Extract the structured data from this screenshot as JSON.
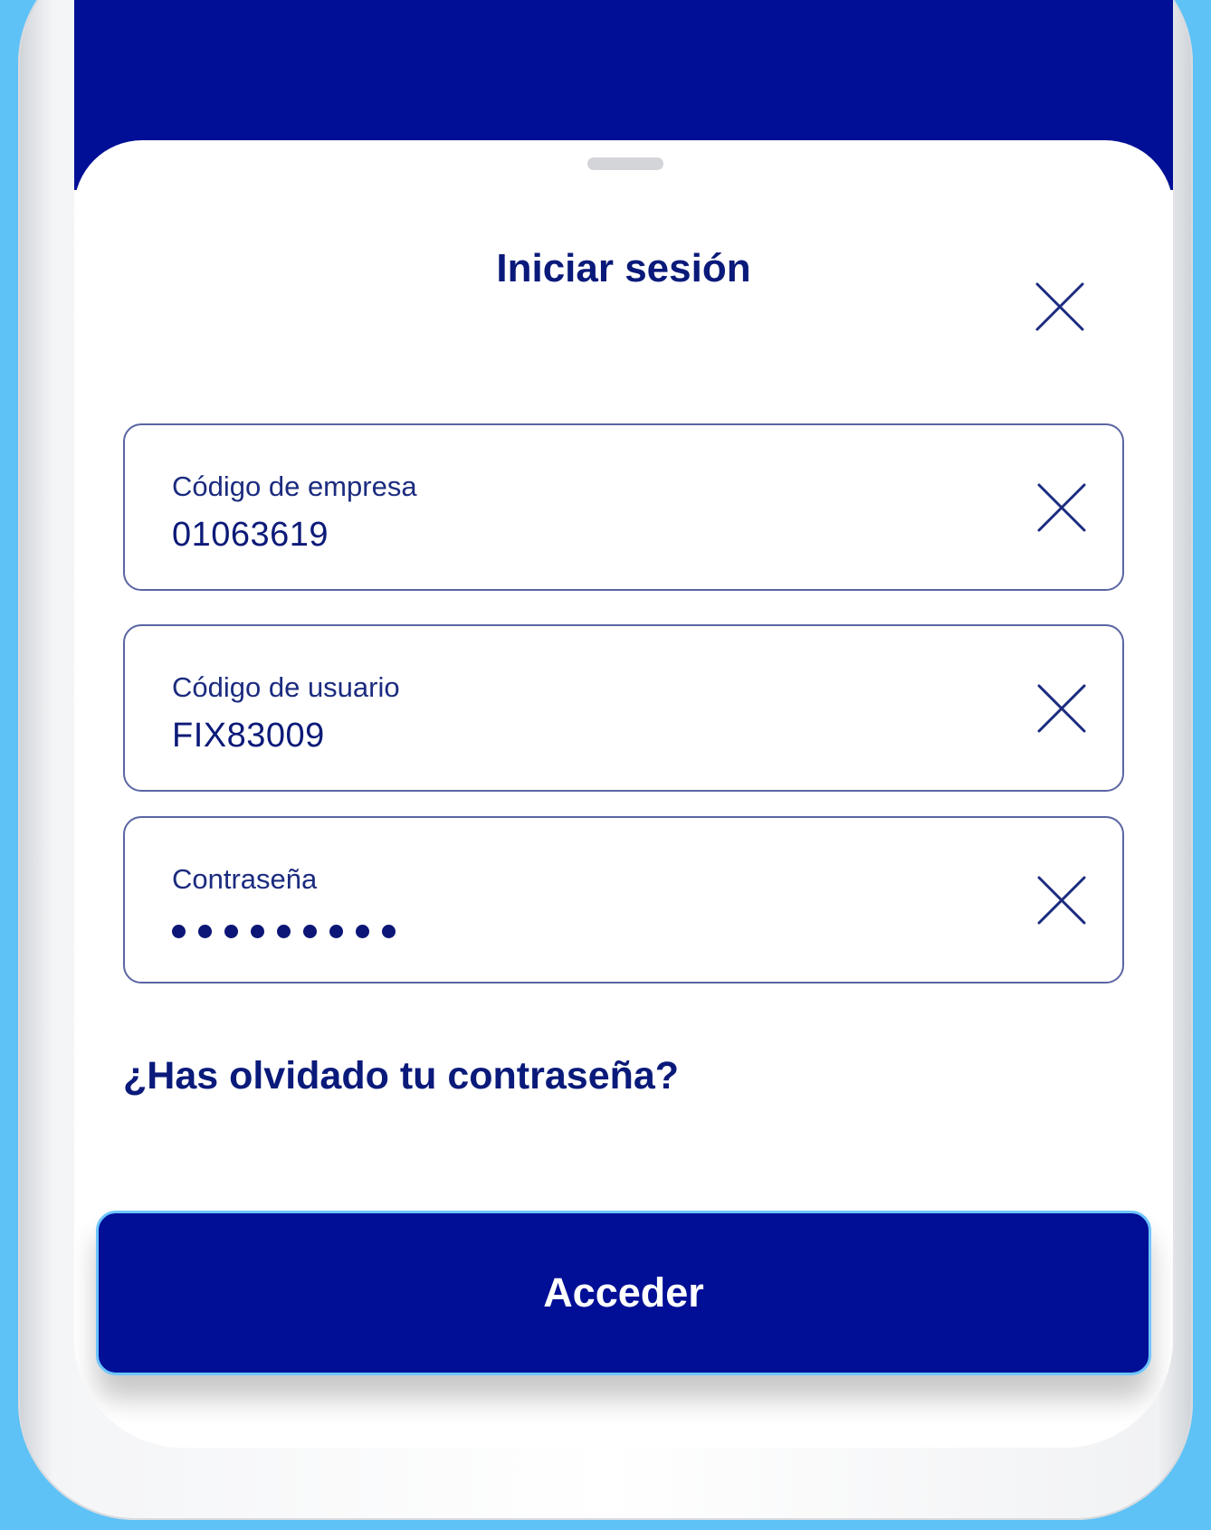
{
  "login_sheet": {
    "title": "Iniciar sesión",
    "close_icon": "close-icon"
  },
  "fields": [
    {
      "label": "Código de empresa",
      "value": "01063619",
      "clear_icon": "clear-icon"
    },
    {
      "label": "Código de usuario",
      "value": "FIX83009",
      "clear_icon": "clear-icon"
    },
    {
      "label": "Contraseña",
      "masked_length": 9,
      "clear_icon": "clear-icon"
    }
  ],
  "forgot_password": "¿Has olvidado tu contraseña?",
  "submit_label": "Acceder",
  "colors": {
    "brand_navy": "#000f96",
    "background_sky": "#5ec2f7",
    "text_navy": "#0a1a7a"
  }
}
